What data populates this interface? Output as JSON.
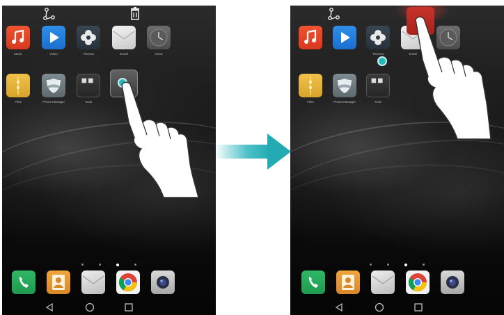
{
  "left_screen": {
    "top_bar": {
      "share_icon": "share-icon",
      "delete_icon": "trash-icon"
    },
    "apps_row1": [
      {
        "label": "Music",
        "icon": "music-note-icon"
      },
      {
        "label": "Video",
        "icon": "play-icon"
      },
      {
        "label": "Themes",
        "icon": "pinwheel-icon"
      },
      {
        "label": "Email",
        "icon": "envelope-icon"
      },
      {
        "label": "Clock",
        "icon": "clock-icon"
      }
    ],
    "apps_row2": [
      {
        "label": "Files",
        "icon": "folder-icon"
      },
      {
        "label": "Phone Manager",
        "icon": "shield-icon"
      },
      {
        "label": "Tools",
        "icon": "folder-grid-icon"
      }
    ],
    "dragged_app": {
      "label": ""
    },
    "page_indicator": {
      "count": 4,
      "active": 3
    },
    "dock": [
      {
        "icon": "phone-icon"
      },
      {
        "icon": "contacts-icon"
      },
      {
        "icon": "messaging-icon"
      },
      {
        "icon": "chrome-icon"
      },
      {
        "icon": "camera-icon"
      }
    ]
  },
  "right_screen": {
    "top_bar": {
      "share_icon": "share-icon"
    },
    "apps_row1": [
      {
        "label": "",
        "icon": "music-note-icon"
      },
      {
        "label": "",
        "icon": "play-icon"
      },
      {
        "label": "Themes",
        "icon": "pinwheel-icon"
      },
      {
        "label": "Email",
        "icon": "envelope-icon"
      },
      {
        "label": "",
        "icon": "clock-icon"
      }
    ],
    "apps_row2": [
      {
        "label": "Files",
        "icon": "folder-icon"
      },
      {
        "label": "Phone Manager",
        "icon": "shield-icon"
      },
      {
        "label": "Tools",
        "icon": "folder-grid-icon"
      }
    ],
    "page_indicator": {
      "count": 4,
      "active": 3
    },
    "dock": [
      {
        "icon": "phone-icon"
      },
      {
        "icon": "contacts-icon"
      },
      {
        "icon": "messaging-icon"
      },
      {
        "icon": "chrome-icon"
      },
      {
        "icon": "camera-icon"
      }
    ]
  },
  "navigation": {
    "back_icon": "back-triangle-icon",
    "home_icon": "home-circle-icon",
    "recents_icon": "recents-square-icon"
  },
  "colors": {
    "touch_point": "#25b8b8",
    "arrow": "#2bb5bd",
    "drop_target": "#c8342c"
  }
}
